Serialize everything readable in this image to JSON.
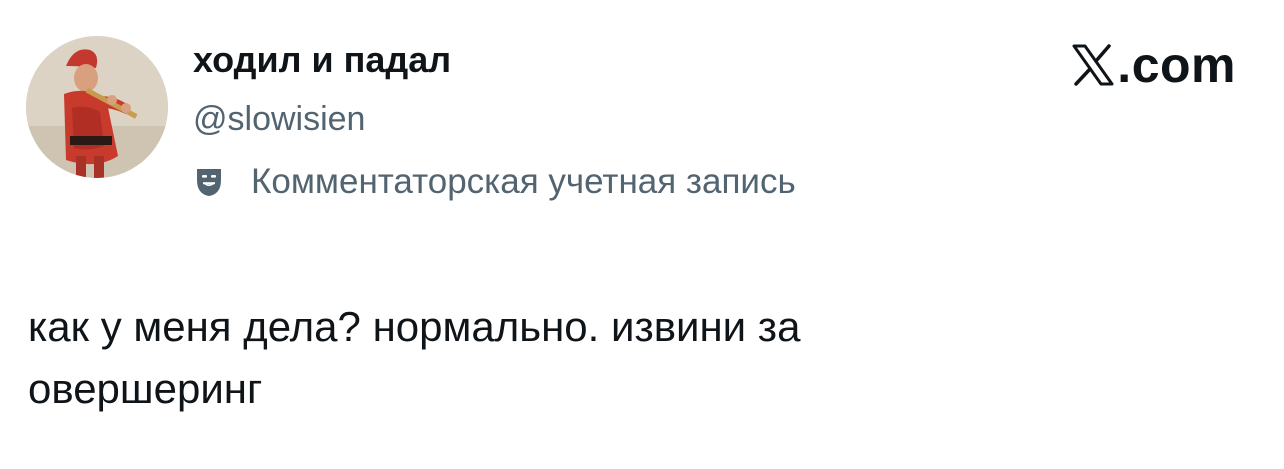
{
  "author": {
    "display_name": "ходил и падал",
    "handle": "@slowisien",
    "avatar_icon": "avatar-photo-flute-player",
    "account_label": "Комментаторская учетная запись",
    "account_label_icon": "parody-mask-icon"
  },
  "site": {
    "logo_icon": "x-logo-icon",
    "domain_suffix": ".com"
  },
  "tweet": {
    "text_lines": [
      "как у меня дела? нормально. извини за",
      "овершеринг"
    ]
  },
  "colors": {
    "text_primary": "#0f1419",
    "text_secondary": "#536471",
    "background": "#ffffff"
  }
}
